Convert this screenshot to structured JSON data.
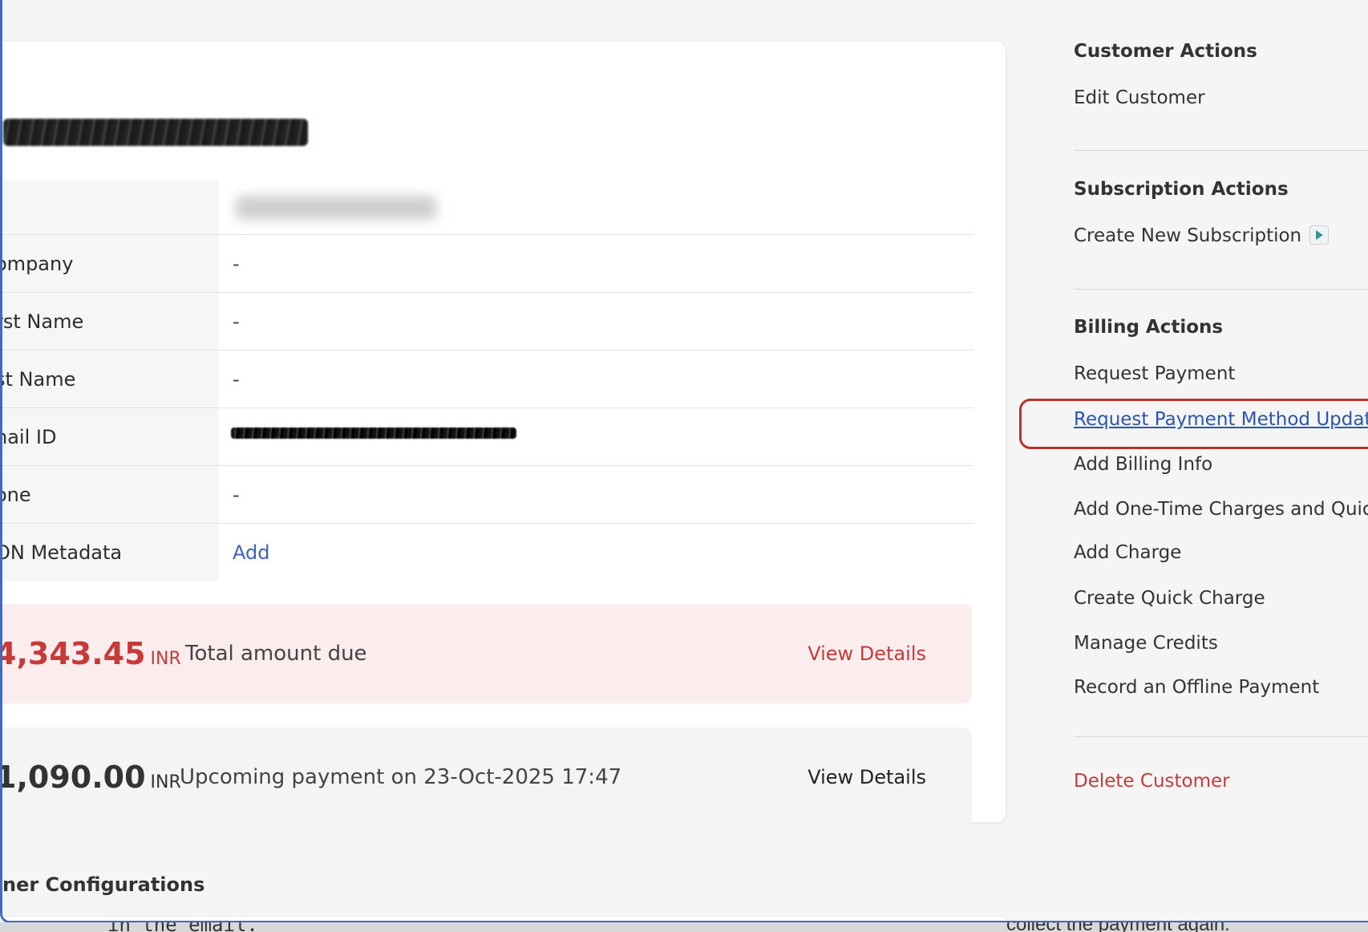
{
  "customer_details": {
    "rows": [
      {
        "label": "",
        "value": ""
      },
      {
        "label": "ompany",
        "value": "-"
      },
      {
        "label": "rst Name",
        "value": "-"
      },
      {
        "label": "st Name",
        "value": "-"
      },
      {
        "label": "nail ID",
        "value": ""
      },
      {
        "label": "one",
        "value": "-"
      },
      {
        "label": "ON Metadata",
        "value": "Add"
      }
    ]
  },
  "amounts": {
    "due": {
      "amount": "4,343.45",
      "currency": "INR",
      "description": "Total amount due",
      "action": "View Details"
    },
    "upcoming": {
      "amount": "1,090.00",
      "currency": "INR",
      "description": "Upcoming payment on 23-Oct-2025 17:47",
      "action": "View Details"
    }
  },
  "configurations_heading": "ner Configurations",
  "sidebar": {
    "customer_actions": {
      "title": "Customer Actions",
      "items": [
        "Edit Customer"
      ]
    },
    "subscription_actions": {
      "title": "Subscription Actions",
      "items": [
        "Create New Subscription"
      ]
    },
    "billing_actions": {
      "title": "Billing Actions",
      "items": [
        "Request Payment",
        "Request Payment Method Update",
        "Add Billing Info",
        "Add One-Time Charges and Quic",
        "Add Charge",
        "Create Quick Charge",
        "Manage Credits",
        "Record an Offline Payment"
      ]
    },
    "delete_label": "Delete Customer"
  },
  "behind_text": {
    "left": "in the email.",
    "right": "collect the payment again."
  },
  "colors": {
    "accent_red": "#c83a3a",
    "link_blue": "#3b63b8",
    "highlight_ring": "#b8322e",
    "frame_blue": "#3d6cc0"
  },
  "icons": {
    "create_subscription": "play-icon"
  }
}
